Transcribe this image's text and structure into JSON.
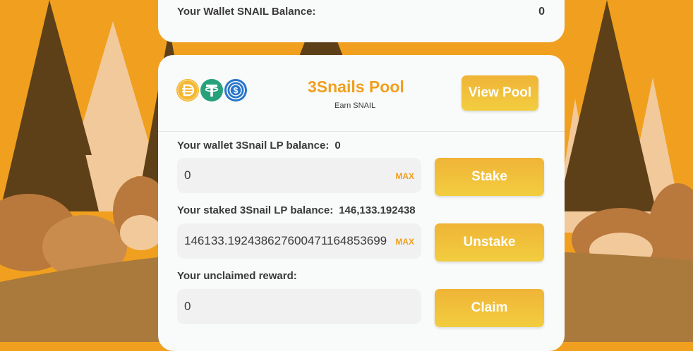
{
  "wallet_snail": {
    "label": "Your Wallet SNAIL Balance:",
    "value": "0"
  },
  "pool": {
    "title": "3Snails Pool",
    "subtitle": "Earn SNAIL",
    "view_button": "View Pool",
    "coins": [
      "dai-icon",
      "usdt-icon",
      "usdc-icon"
    ]
  },
  "stake_section": {
    "label": "Your wallet 3Snail LP balance:",
    "value": "0",
    "input_value": "0",
    "max_label": "MAX",
    "button": "Stake"
  },
  "unstake_section": {
    "label": "Your staked 3Snail LP balance:",
    "value": "146,133.192438",
    "input_value": "146133.192438627600471164853699",
    "max_label": "MAX",
    "button": "Unstake"
  },
  "claim_section": {
    "label": "Your unclaimed reward:",
    "input_value": "0",
    "button": "Claim"
  },
  "colors": {
    "accent": "#f0a01e",
    "button_top": "#f0b437",
    "button_bottom": "#f2cd3f",
    "background": "#f0a01e",
    "tree_dark": "#5e4018",
    "tree_light": "#f2c99a",
    "bush": "#b9783c",
    "hill": "#a97a3c"
  }
}
